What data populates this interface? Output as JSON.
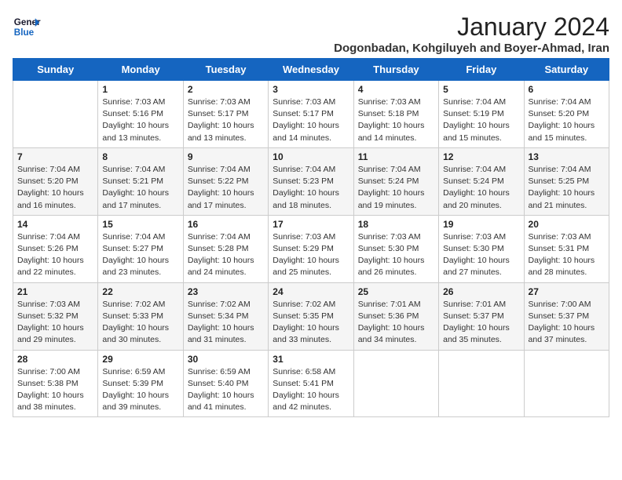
{
  "logo": {
    "line1": "General",
    "line2": "Blue"
  },
  "title": "January 2024",
  "location": "Dogonbadan, Kohgiluyeh and Boyer-Ahmad, Iran",
  "days_of_week": [
    "Sunday",
    "Monday",
    "Tuesday",
    "Wednesday",
    "Thursday",
    "Friday",
    "Saturday"
  ],
  "weeks": [
    [
      {
        "day": "",
        "info": ""
      },
      {
        "day": "1",
        "info": "Sunrise: 7:03 AM\nSunset: 5:16 PM\nDaylight: 10 hours\nand 13 minutes."
      },
      {
        "day": "2",
        "info": "Sunrise: 7:03 AM\nSunset: 5:17 PM\nDaylight: 10 hours\nand 13 minutes."
      },
      {
        "day": "3",
        "info": "Sunrise: 7:03 AM\nSunset: 5:17 PM\nDaylight: 10 hours\nand 14 minutes."
      },
      {
        "day": "4",
        "info": "Sunrise: 7:03 AM\nSunset: 5:18 PM\nDaylight: 10 hours\nand 14 minutes."
      },
      {
        "day": "5",
        "info": "Sunrise: 7:04 AM\nSunset: 5:19 PM\nDaylight: 10 hours\nand 15 minutes."
      },
      {
        "day": "6",
        "info": "Sunrise: 7:04 AM\nSunset: 5:20 PM\nDaylight: 10 hours\nand 15 minutes."
      }
    ],
    [
      {
        "day": "7",
        "info": "Sunrise: 7:04 AM\nSunset: 5:20 PM\nDaylight: 10 hours\nand 16 minutes."
      },
      {
        "day": "8",
        "info": "Sunrise: 7:04 AM\nSunset: 5:21 PM\nDaylight: 10 hours\nand 17 minutes."
      },
      {
        "day": "9",
        "info": "Sunrise: 7:04 AM\nSunset: 5:22 PM\nDaylight: 10 hours\nand 17 minutes."
      },
      {
        "day": "10",
        "info": "Sunrise: 7:04 AM\nSunset: 5:23 PM\nDaylight: 10 hours\nand 18 minutes."
      },
      {
        "day": "11",
        "info": "Sunrise: 7:04 AM\nSunset: 5:24 PM\nDaylight: 10 hours\nand 19 minutes."
      },
      {
        "day": "12",
        "info": "Sunrise: 7:04 AM\nSunset: 5:24 PM\nDaylight: 10 hours\nand 20 minutes."
      },
      {
        "day": "13",
        "info": "Sunrise: 7:04 AM\nSunset: 5:25 PM\nDaylight: 10 hours\nand 21 minutes."
      }
    ],
    [
      {
        "day": "14",
        "info": "Sunrise: 7:04 AM\nSunset: 5:26 PM\nDaylight: 10 hours\nand 22 minutes."
      },
      {
        "day": "15",
        "info": "Sunrise: 7:04 AM\nSunset: 5:27 PM\nDaylight: 10 hours\nand 23 minutes."
      },
      {
        "day": "16",
        "info": "Sunrise: 7:04 AM\nSunset: 5:28 PM\nDaylight: 10 hours\nand 24 minutes."
      },
      {
        "day": "17",
        "info": "Sunrise: 7:03 AM\nSunset: 5:29 PM\nDaylight: 10 hours\nand 25 minutes."
      },
      {
        "day": "18",
        "info": "Sunrise: 7:03 AM\nSunset: 5:30 PM\nDaylight: 10 hours\nand 26 minutes."
      },
      {
        "day": "19",
        "info": "Sunrise: 7:03 AM\nSunset: 5:30 PM\nDaylight: 10 hours\nand 27 minutes."
      },
      {
        "day": "20",
        "info": "Sunrise: 7:03 AM\nSunset: 5:31 PM\nDaylight: 10 hours\nand 28 minutes."
      }
    ],
    [
      {
        "day": "21",
        "info": "Sunrise: 7:03 AM\nSunset: 5:32 PM\nDaylight: 10 hours\nand 29 minutes."
      },
      {
        "day": "22",
        "info": "Sunrise: 7:02 AM\nSunset: 5:33 PM\nDaylight: 10 hours\nand 30 minutes."
      },
      {
        "day": "23",
        "info": "Sunrise: 7:02 AM\nSunset: 5:34 PM\nDaylight: 10 hours\nand 31 minutes."
      },
      {
        "day": "24",
        "info": "Sunrise: 7:02 AM\nSunset: 5:35 PM\nDaylight: 10 hours\nand 33 minutes."
      },
      {
        "day": "25",
        "info": "Sunrise: 7:01 AM\nSunset: 5:36 PM\nDaylight: 10 hours\nand 34 minutes."
      },
      {
        "day": "26",
        "info": "Sunrise: 7:01 AM\nSunset: 5:37 PM\nDaylight: 10 hours\nand 35 minutes."
      },
      {
        "day": "27",
        "info": "Sunrise: 7:00 AM\nSunset: 5:37 PM\nDaylight: 10 hours\nand 37 minutes."
      }
    ],
    [
      {
        "day": "28",
        "info": "Sunrise: 7:00 AM\nSunset: 5:38 PM\nDaylight: 10 hours\nand 38 minutes."
      },
      {
        "day": "29",
        "info": "Sunrise: 6:59 AM\nSunset: 5:39 PM\nDaylight: 10 hours\nand 39 minutes."
      },
      {
        "day": "30",
        "info": "Sunrise: 6:59 AM\nSunset: 5:40 PM\nDaylight: 10 hours\nand 41 minutes."
      },
      {
        "day": "31",
        "info": "Sunrise: 6:58 AM\nSunset: 5:41 PM\nDaylight: 10 hours\nand 42 minutes."
      },
      {
        "day": "",
        "info": ""
      },
      {
        "day": "",
        "info": ""
      },
      {
        "day": "",
        "info": ""
      }
    ]
  ]
}
